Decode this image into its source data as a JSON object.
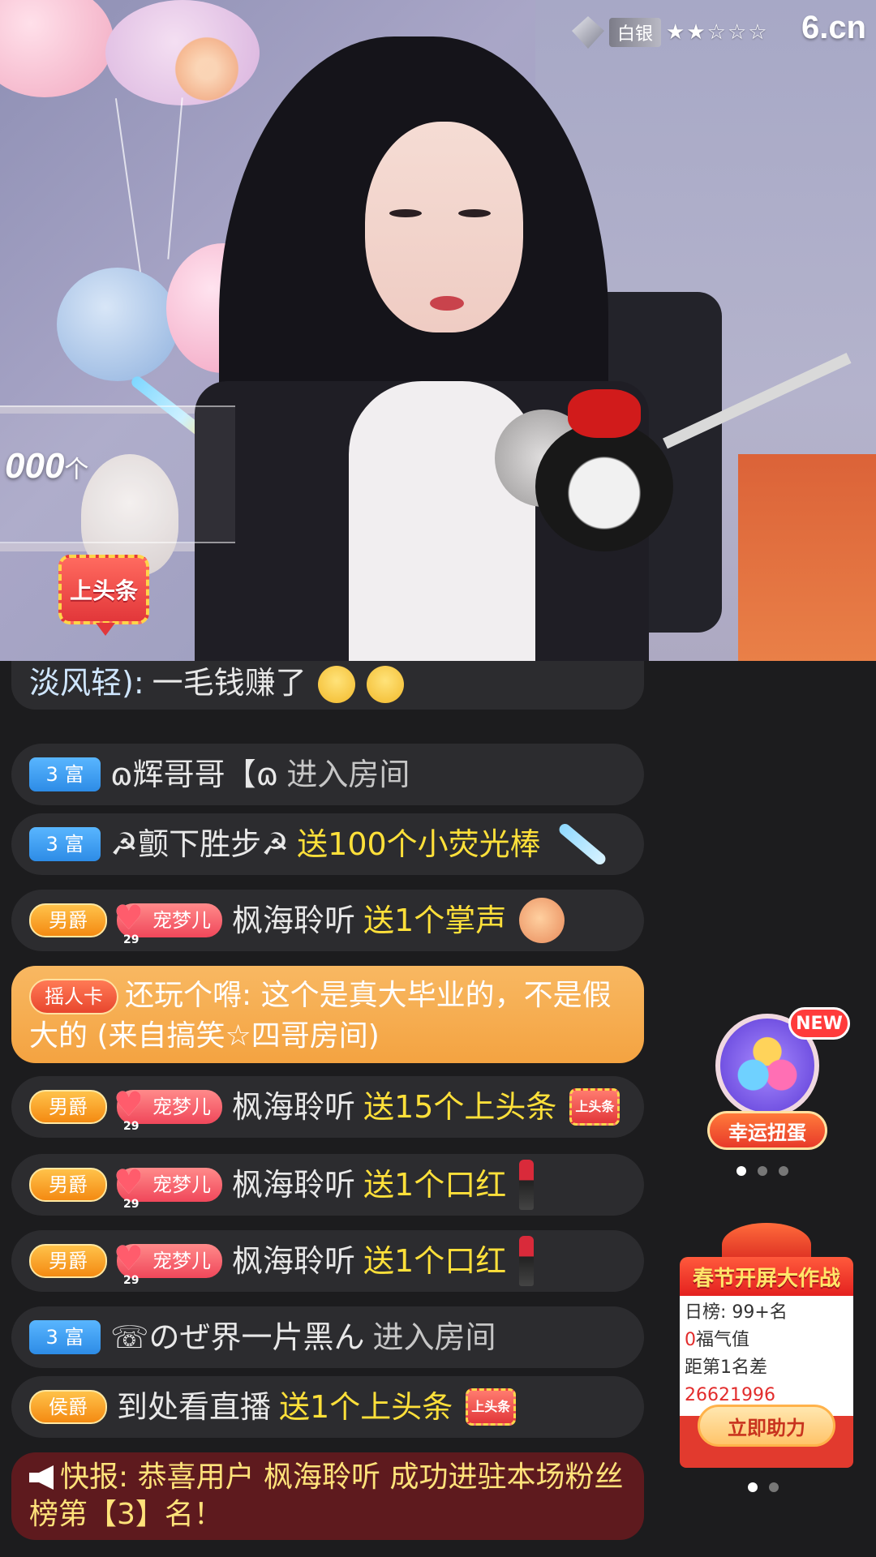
{
  "stream": {
    "rank_label": "白银",
    "stars": "★★☆☆☆",
    "logo": "6.cn",
    "counter_value": "000",
    "counter_unit": "个",
    "headline_button": "上头条"
  },
  "chat": {
    "partial_top": {
      "user": "淡风轻):",
      "text": "一毛钱赚了"
    },
    "messages": [
      {
        "tag": "3 富",
        "user": "ɷ辉哥哥【ɷ",
        "action": "进入房间"
      },
      {
        "tag": "3 富",
        "user": "☭颤下胜步☭",
        "action": "送100个小荧光棒",
        "gift": "glow-stick-icon"
      },
      {
        "tag": "男爵",
        "fan_badge": "宠梦儿",
        "fan_level": "29",
        "user": "枫海聆听",
        "action": "送1个掌声",
        "gift": "applause-icon"
      },
      {
        "tag": "男爵",
        "fan_badge": "宠梦儿",
        "fan_level": "29",
        "user": "枫海聆听",
        "action": "送15个上头条",
        "gift": "headline-icon"
      },
      {
        "tag": "男爵",
        "fan_badge": "宠梦儿",
        "fan_level": "29",
        "user": "枫海聆听",
        "action": "送1个口红",
        "gift": "lipstick-icon"
      },
      {
        "tag": "男爵",
        "fan_badge": "宠梦儿",
        "fan_level": "29",
        "user": "枫海聆听",
        "action": "送1个口红",
        "gift": "lipstick-icon"
      },
      {
        "tag": "3 富",
        "user": "☏のぜ界一片黑ん",
        "action": "进入房间"
      },
      {
        "tag": "侯爵",
        "user": "到处看直播",
        "action": "送1个上头条",
        "gift": "headline-icon"
      }
    ],
    "shake_card": {
      "tag": "摇人卡",
      "text": "还玩个嘚: 这个是真大毕业的，不是假大的 (来自搞笑☆四哥房间)"
    },
    "news": "快报: 恭喜用户 枫海聆听 成功进驻本场粉丝榜第【3】名！",
    "gift_headline_text": "上头条"
  },
  "widgets": {
    "egg": {
      "new_badge": "NEW",
      "label": "幸运扭蛋"
    },
    "spring": {
      "title": "春节开屏大作战",
      "rank_line": "日榜: 99+名",
      "score_value": "0",
      "score_label": "福气值",
      "gap_label": "距第1名差",
      "gap_value": "26621996",
      "button": "立即助力"
    }
  }
}
